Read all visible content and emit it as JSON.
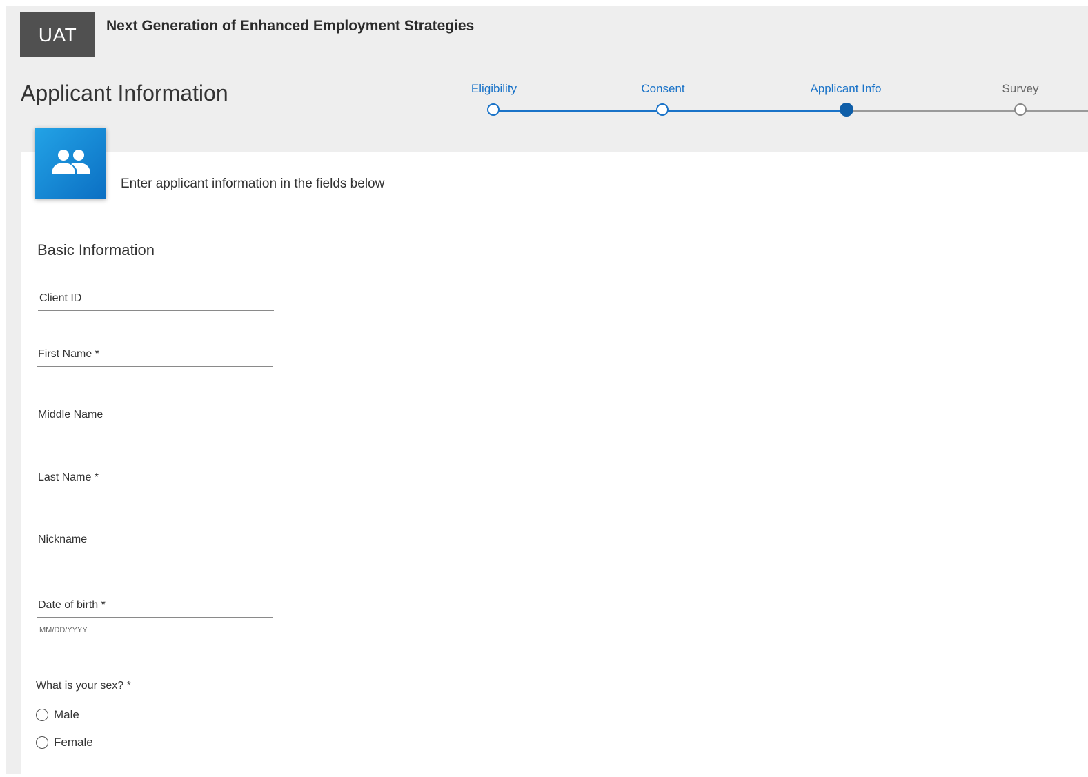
{
  "header": {
    "env_badge": "UAT",
    "app_title": "Next Generation of Enhanced Employment Strategies"
  },
  "page": {
    "title": "Applicant Information"
  },
  "stepper": {
    "steps": [
      {
        "label": "Eligibility",
        "state": "done"
      },
      {
        "label": "Consent",
        "state": "done"
      },
      {
        "label": "Applicant Info",
        "state": "current"
      },
      {
        "label": "Survey",
        "state": "todo"
      }
    ],
    "colors": {
      "done": "#1a73c8",
      "current": "#0f5ea8",
      "todo": "#9a9a9a"
    }
  },
  "card": {
    "icon": "people-icon",
    "intro": "Enter applicant information in the fields below",
    "section_title": "Basic Information",
    "fields": {
      "client_id": {
        "placeholder": "Client ID",
        "value": ""
      },
      "first_name": {
        "placeholder": "First Name *",
        "value": ""
      },
      "middle_name": {
        "placeholder": "Middle Name",
        "value": ""
      },
      "last_name": {
        "placeholder": "Last Name *",
        "value": ""
      },
      "nickname": {
        "placeholder": "Nickname",
        "value": ""
      },
      "dob": {
        "placeholder": "Date of birth *",
        "value": "",
        "hint": "MM/DD/YYYY"
      }
    },
    "sex_question": {
      "label": "What is your sex? *",
      "options": [
        "Male",
        "Female"
      ]
    }
  }
}
